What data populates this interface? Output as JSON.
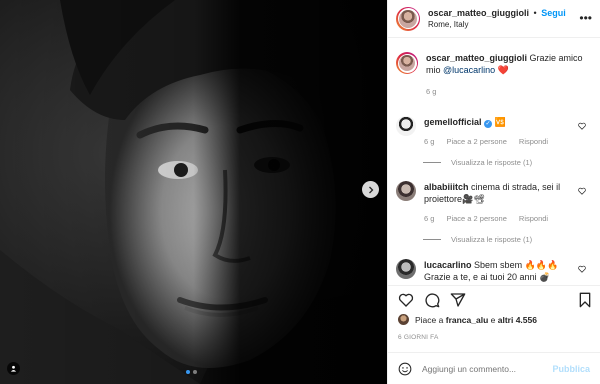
{
  "header": {
    "username": "oscar_matteo_giuggioli",
    "separator": "•",
    "follow_label": "Segui",
    "location": "Rome, Italy"
  },
  "caption": {
    "username": "oscar_matteo_giuggioli",
    "text": "Grazie amico mio",
    "mention": "@lucacarlino",
    "emoji": "❤️",
    "time": "6 g"
  },
  "comments": [
    {
      "username": "gemellofficial",
      "text": "🆚",
      "time": "6 g",
      "likes": "Piace a 2 persone",
      "reply": "Rispondi",
      "view_replies": "Visualizza le risposte (1)"
    },
    {
      "username": "albabiiitch",
      "text": "cinema di strada, sei il proiettore🎥📽",
      "time": "6 g",
      "likes": "Piace a 2 persone",
      "reply": "Rispondi",
      "view_replies": "Visualizza le risposte (1)"
    },
    {
      "username": "lucacarlino",
      "text": "Sbem sbem 🔥🔥🔥 Grazie a te, e ai tuoi 20 anni 💣"
    }
  ],
  "likes": {
    "prefix": "Piace a",
    "user": "franca_alu",
    "middle": "e",
    "others": "altri 4.556"
  },
  "date": "6 GIORNI FA",
  "add_comment": {
    "placeholder": "Aggiungi un commento...",
    "publish_label": "Pubblica"
  },
  "colors": {
    "accent": "#0095f6",
    "heart": "#ed4956",
    "muted": "#8e8e8e"
  },
  "icons": [
    "chevron-right-icon",
    "user-tag-icon",
    "more-icon",
    "heart-icon",
    "comment-icon",
    "share-icon",
    "bookmark-icon",
    "emoji-icon",
    "verified-icon"
  ]
}
